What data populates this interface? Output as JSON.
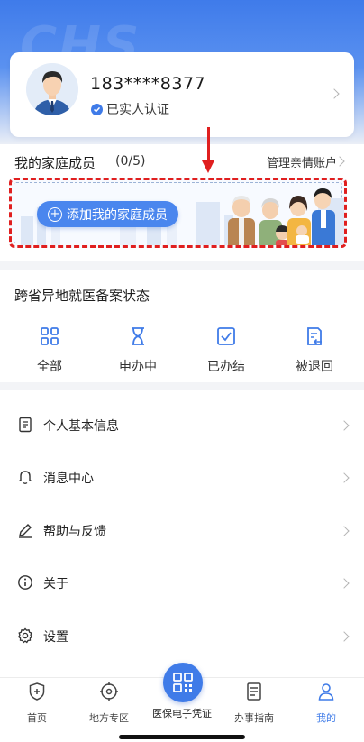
{
  "hero": {
    "watermark": "CHS"
  },
  "profile": {
    "phone": "183****8377",
    "verify_status": "已实人认证"
  },
  "family": {
    "title": "我的家庭成员",
    "count": "(0/5)",
    "manage_label": "管理亲情账户",
    "add_button": "添加我的家庭成员"
  },
  "filing": {
    "title": "跨省异地就医备案状态",
    "statuses": [
      {
        "label": "全部",
        "icon": "grid-icon"
      },
      {
        "label": "申办中",
        "icon": "hourglass-icon"
      },
      {
        "label": "已办结",
        "icon": "checkbox-icon"
      },
      {
        "label": "被退回",
        "icon": "returned-doc-icon"
      }
    ]
  },
  "menu": {
    "items": [
      {
        "label": "个人基本信息",
        "icon": "document-icon"
      },
      {
        "label": "消息中心",
        "icon": "bell-icon"
      },
      {
        "label": "帮助与反馈",
        "icon": "pen-icon"
      },
      {
        "label": "关于",
        "icon": "info-icon"
      },
      {
        "label": "设置",
        "icon": "gear-icon"
      }
    ]
  },
  "tabbar": {
    "tabs": [
      {
        "label": "首页",
        "icon": "shield-plus-icon"
      },
      {
        "label": "地方专区",
        "icon": "location-target-icon"
      },
      {
        "label": "医保电子凭证",
        "icon": "qr-code-icon"
      },
      {
        "label": "办事指南",
        "icon": "guide-doc-icon"
      },
      {
        "label": "我的",
        "icon": "user-icon"
      }
    ],
    "active_tab": "我的"
  },
  "colors": {
    "accent": "#3f7be8",
    "annotation_red": "#e01f1f",
    "background": "#f3f4f7"
  }
}
